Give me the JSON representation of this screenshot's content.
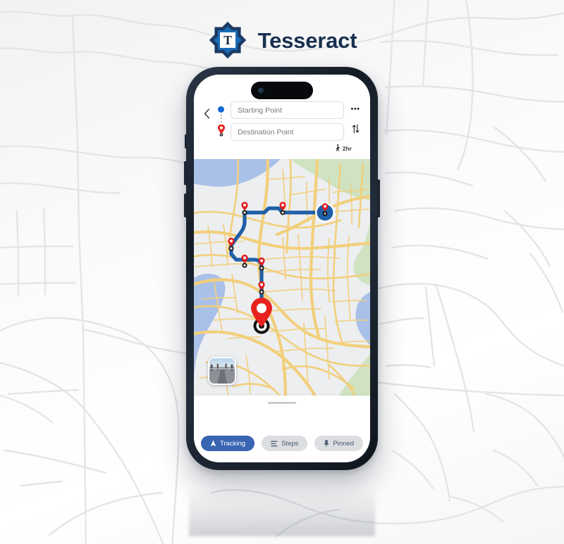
{
  "brand": {
    "name": "Tesseract",
    "logo_icon": "tesseract-star-logo",
    "logo_letter": "T",
    "logo_color_outer": "#1c3a63",
    "logo_color_inner": "#1a6bb5",
    "wordmark_color": "#18304f"
  },
  "phone": {
    "device": "smartphone-mockup",
    "dynamic_island": "dynamic-island",
    "camera": "front-camera-dot"
  },
  "nav_panel": {
    "back_icon": "chevron-left-icon",
    "start_dot_icon": "start-point-dot-icon",
    "route_dots_icon": "route-dots-icon",
    "destination_pin_icon": "destination-pin-icon",
    "more_icon": "more-options-icon",
    "more_label": "•••",
    "swap_icon": "swap-vertical-icon",
    "start_field": {
      "name": "starting-point-input",
      "value": "",
      "placeholder": "Starting Point"
    },
    "destination_field": {
      "name": "destination-point-input",
      "value": "",
      "placeholder": "Destination Point"
    },
    "eta": {
      "mode_icon": "walking-person-icon",
      "duration": "2hr"
    }
  },
  "map": {
    "colors": {
      "land": "#eef0f2",
      "water": "#a9c0e8",
      "park": "#cfe3c2",
      "road": "#f6d582",
      "road_casing": "#eac45f",
      "route": "#1f5fa8",
      "marker": "#e11d1d"
    },
    "route": {
      "name": "route-polyline",
      "start_marker": "current-location-marker",
      "end_marker": "destination-marker",
      "waypoint_count": 6
    },
    "street_view_thumbnail": {
      "name": "street-view-thumbnail",
      "label": "Street View"
    }
  },
  "sheet": {
    "grabber": "sheet-drag-handle",
    "chips": [
      {
        "label": "Tracking",
        "icon": "navigation-arrow-icon",
        "active": true
      },
      {
        "label": "Steps",
        "icon": "list-steps-icon",
        "active": false
      },
      {
        "label": "Pinned",
        "icon": "pin-icon",
        "active": false
      }
    ]
  }
}
